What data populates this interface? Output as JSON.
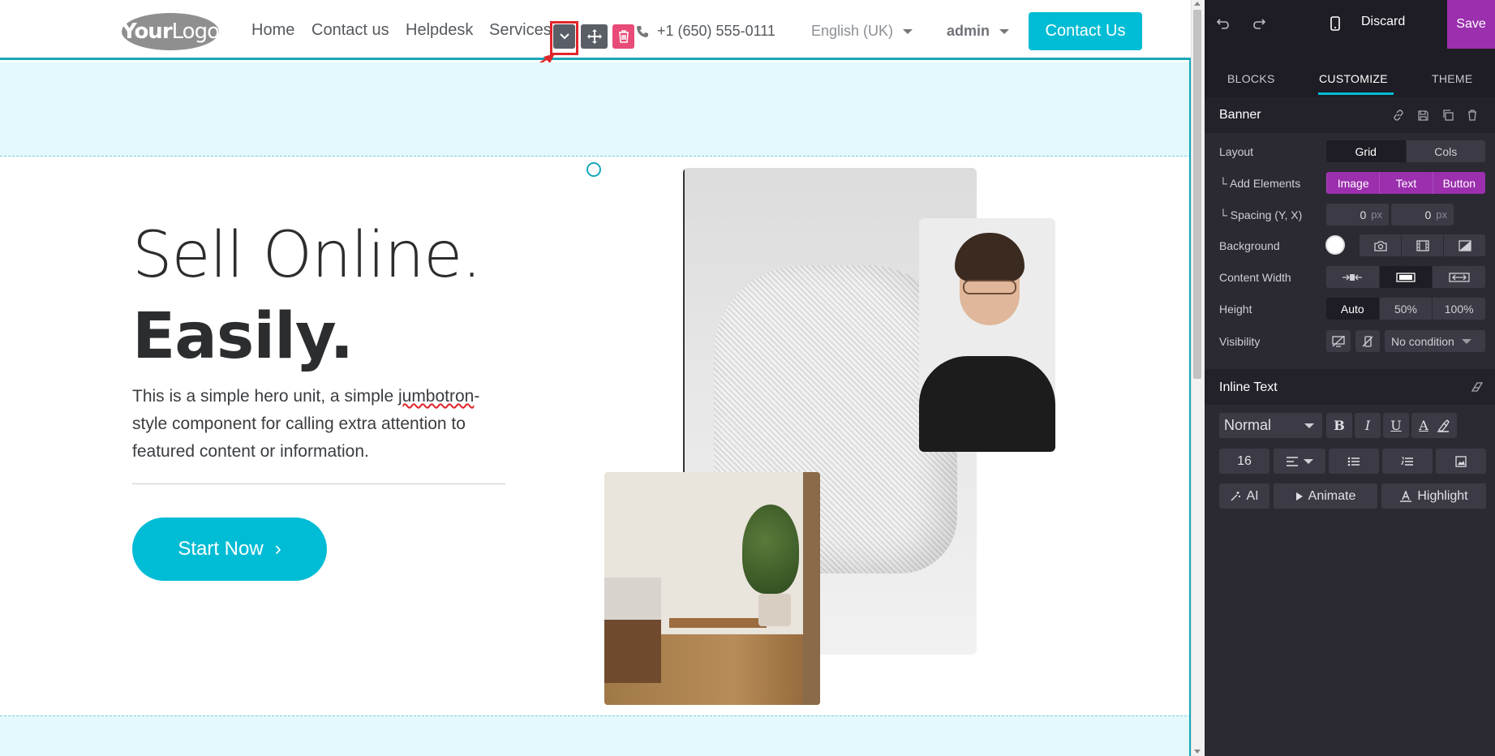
{
  "site": {
    "logo_text_bold": "Your",
    "logo_text_thin": "Logo",
    "nav": [
      "Home",
      "Contact us",
      "Helpdesk",
      "Services"
    ],
    "phone": "+1 (650) 555-0111",
    "language": "English (UK)",
    "user": "admin",
    "cta": "Contact Us"
  },
  "hero": {
    "line1": "Sell Online.",
    "line2": "Easily.",
    "para_before": "This is a simple hero unit, a simple ",
    "para_squiggle": "jumbotron",
    "para_after": "-style component for calling extra attention to featured content or information.",
    "button": "Start Now",
    "button_chevron": "›"
  },
  "editor": {
    "discard": "Discard",
    "save": "Save",
    "tabs": [
      "BLOCKS",
      "CUSTOMIZE",
      "THEME"
    ],
    "active_tab": "CUSTOMIZE",
    "banner": {
      "title": "Banner",
      "layout_label": "Layout",
      "layout_options": [
        "Grid",
        "Cols"
      ],
      "layout_selected": "Grid",
      "add_elements_label": "└ Add Elements",
      "add_elements": [
        "Image",
        "Text",
        "Button"
      ],
      "spacing_label": "└ Spacing (Y, X)",
      "spacing_y": "0",
      "spacing_x": "0",
      "spacing_unit": "px",
      "background_label": "Background",
      "content_width_label": "Content Width",
      "height_label": "Height",
      "height_options": [
        "Auto",
        "50%",
        "100%"
      ],
      "height_selected": "Auto",
      "visibility_label": "Visibility",
      "visibility_condition": "No condition"
    },
    "inline_text": {
      "title": "Inline Text",
      "style": "Normal",
      "font_size": "16",
      "ai": "AI",
      "animate": "Animate",
      "highlight": "Highlight"
    }
  },
  "colors": {
    "accent": "#00bcd4",
    "brand_purple": "#9b2fae",
    "delete_pink": "#e84b78",
    "annotation_red": "#e0262c"
  }
}
